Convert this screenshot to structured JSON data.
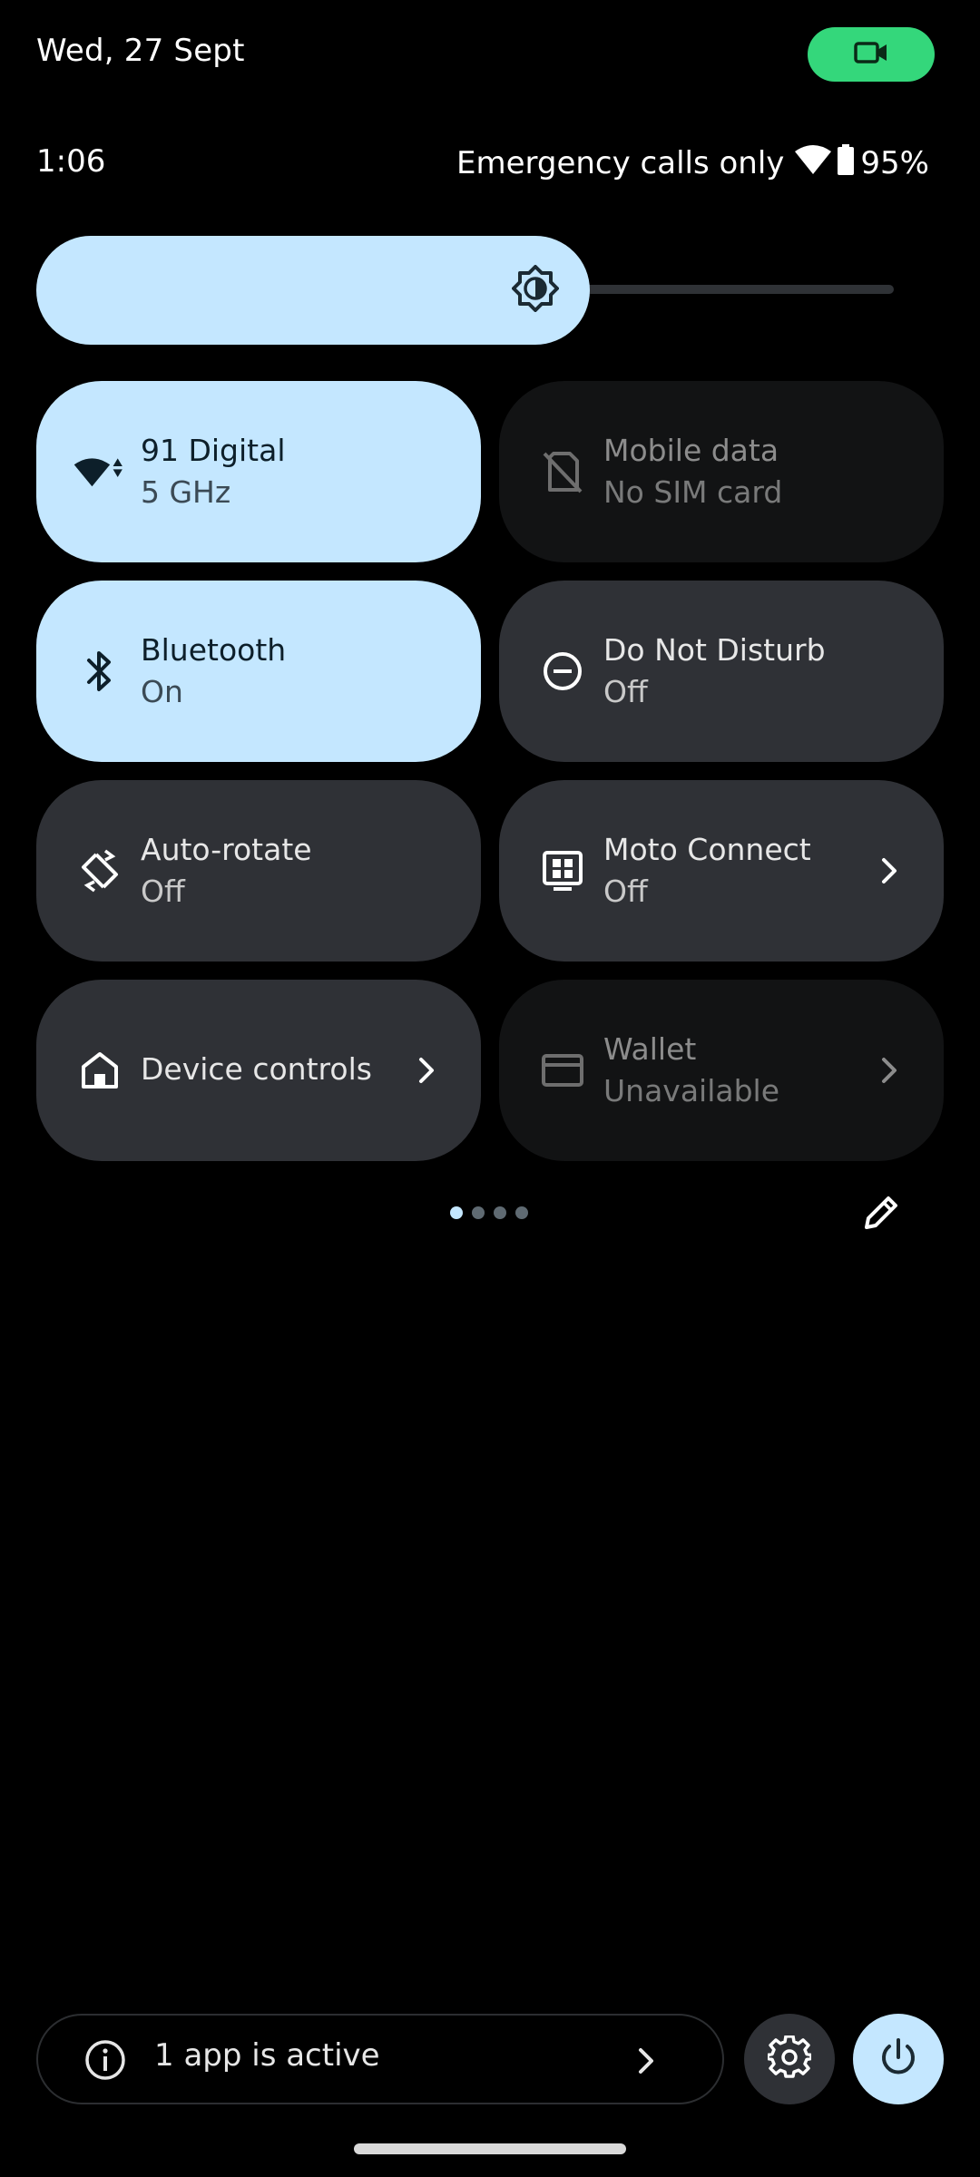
{
  "status_bar": {
    "date": "Wed, 27 Sept",
    "time": "1:06",
    "network_text": "Emergency calls only",
    "battery": "95%",
    "camera_indicator_icon": "video-camera-icon",
    "wifi_icon": "wifi-icon",
    "battery_icon": "battery-icon"
  },
  "brightness": {
    "level": 0.55,
    "icon": "brightness-icon"
  },
  "tiles": [
    {
      "title": "91 Digital",
      "subtitle": "5 GHz",
      "state": "active",
      "icon": "wifi-icon"
    },
    {
      "title": "Mobile data",
      "subtitle": "No SIM card",
      "state": "unavailable",
      "icon": "no-sim-icon"
    },
    {
      "title": "Bluetooth",
      "subtitle": "On",
      "state": "active",
      "icon": "bluetooth-icon"
    },
    {
      "title": "Do Not Disturb",
      "subtitle": "Off",
      "state": "inactive",
      "icon": "do-not-disturb-icon"
    },
    {
      "title": "Auto-rotate",
      "subtitle": "Off",
      "state": "inactive",
      "icon": "auto-rotate-icon"
    },
    {
      "title": "Moto Connect",
      "subtitle": "Off",
      "state": "inactive",
      "icon": "moto-connect-icon"
    },
    {
      "title": "Device controls",
      "subtitle": "",
      "state": "inactive",
      "icon": "home-icon"
    },
    {
      "title": "Wallet",
      "subtitle": "Unavailable",
      "state": "unavailable",
      "icon": "wallet-icon"
    }
  ],
  "pager": {
    "pages": 4,
    "current": 1
  },
  "footer": {
    "active_apps_label": "1 app is active",
    "settings_icon": "gear-icon",
    "power_icon": "power-icon"
  },
  "colors": {
    "accent": "#c4e7ff",
    "tile_inactive": "#2f3136",
    "tile_unavailable": "#121314",
    "camera_indicator": "#34d77b",
    "background": "#000000"
  }
}
